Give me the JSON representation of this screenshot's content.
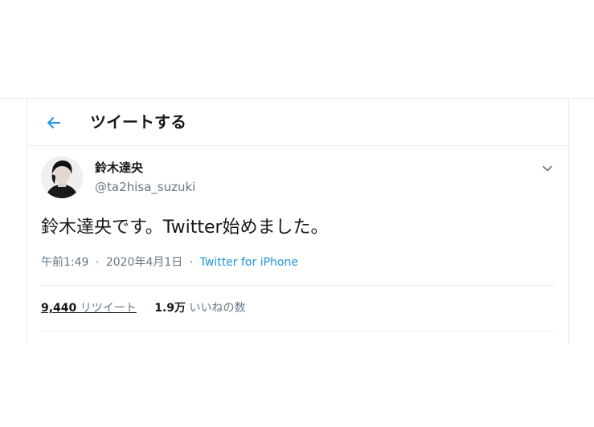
{
  "header": {
    "title": "ツイートする",
    "back_icon": "arrow-left-icon"
  },
  "colors": {
    "accent": "#1b95e0",
    "text": "#14171a",
    "secondary": "#657786",
    "divider": "#e6ecf0"
  },
  "tweet": {
    "display_name": "鈴木達央",
    "username": "@ta2hisa_suzuki",
    "text": "鈴木達央です。Twitter始めました。",
    "time": "午前1:49",
    "separator": "·",
    "date": "2020年4月1日",
    "source": "Twitter for iPhone"
  },
  "stats": {
    "retweets_count": "9,440",
    "retweets_label": "リツイート",
    "likes_count": "1.9万",
    "likes_label": "いいねの数"
  }
}
